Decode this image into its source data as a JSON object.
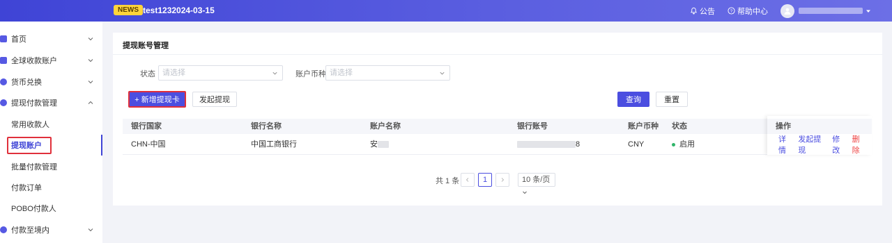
{
  "header": {
    "badge": "NEWS",
    "title": "test1232024-03-15",
    "announcement": "公告",
    "help": "帮助中心"
  },
  "sidebar": {
    "items": [
      {
        "label": "首页",
        "type": "top"
      },
      {
        "label": "全球收款账户",
        "type": "top"
      },
      {
        "label": "货币兑换",
        "type": "top"
      },
      {
        "label": "提现付款管理",
        "type": "top",
        "expanded": true
      },
      {
        "label": "常用收款人",
        "type": "sub"
      },
      {
        "label": "提现账户",
        "type": "sub",
        "active": true
      },
      {
        "label": "批量付款管理",
        "type": "sub"
      },
      {
        "label": "付款订单",
        "type": "sub"
      },
      {
        "label": "POBO付款人",
        "type": "sub"
      },
      {
        "label": "付款至境内",
        "type": "top"
      }
    ]
  },
  "page": {
    "title": "提现账号管理",
    "filters": {
      "status_label": "状态",
      "status_placeholder": "请选择",
      "currency_label": "账户币种",
      "currency_placeholder": "请选择"
    },
    "buttons": {
      "add_card": "+ 新增提现卡",
      "withdraw": "发起提现",
      "query": "查询",
      "reset": "重置"
    },
    "table": {
      "columns": [
        "银行国家",
        "银行名称",
        "账户名称",
        "银行账号",
        "账户币种",
        "状态",
        "操作"
      ],
      "rows": [
        {
          "country": "CHN-中国",
          "bank": "中国工商银行",
          "account_name": "安",
          "account_no_suffix": "8",
          "currency": "CNY",
          "status": "启用",
          "ops": [
            "详情",
            "发起提现",
            "修改",
            "删除"
          ]
        }
      ]
    },
    "pagination": {
      "total": "共 1 条",
      "current": "1",
      "page_size": "10 条/页"
    }
  },
  "colors": {
    "brand": "#4b4ee0",
    "header_gradient_start": "#3f44d6",
    "header_gradient_end": "#6c6fe6",
    "status_enabled": "#30b56a",
    "danger": "#ee4444",
    "highlight_box": "#e0303b"
  }
}
